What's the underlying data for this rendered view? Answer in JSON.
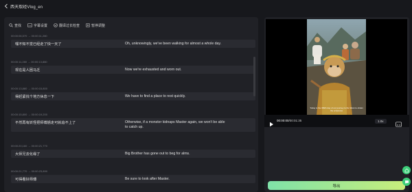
{
  "window": {
    "title": "西天取经Vlog_en"
  },
  "toolbar": {
    "find": "查找",
    "subtitle_settings": "字幕设置",
    "translation_check": "翻译过长检查",
    "batch_adjust": "暂停调整"
  },
  "segments": [
    {
      "time": "00:00:06,570 → 00:00:11,280",
      "source": "嘿不知不觉已经走了快一天了",
      "target": "Oh, unknowingly, we've been walking for almost a whole day."
    },
    {
      "time": "00:00:11,280 → 00:00:13,880",
      "source": "现在是人困马乏",
      "target": "Now we're exhausted and worn out."
    },
    {
      "time": "00:00:13,880 → 00:00:15,800",
      "source": "得赶紧找个地方休息一下",
      "target": "We have to find a place to rest quickly."
    },
    {
      "time": "00:00:15,800 → 00:00:19,200",
      "source": "不然再有妖怪把师傅掳走可就追不上了",
      "target": "Otherwise, if a monster kidnaps Master again, we won't be able",
      "target2": "to catch up."
    },
    {
      "time": "00:00:20,160 → 00:00:21,770",
      "source": "大师兄去化缘了",
      "target": "Big Brother has gone out to beg for alms."
    },
    {
      "time": "00:00:21,770 → 00:00:23,890",
      "source": "可得看好师傅",
      "target": "Be sure to look after Master."
    }
  ],
  "player": {
    "current": "00:00:00",
    "total": "00:01:35",
    "speed": "1.0x",
    "subtitle_en": "Today is the 369th day of our journey to the West to obtain the scriptures"
  },
  "export": {
    "label": "导出"
  }
}
